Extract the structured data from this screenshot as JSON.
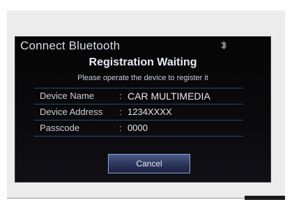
{
  "dialog": {
    "title": "Connect Bluetooth",
    "heading": "Registration Waiting",
    "subtitle": "Please operate the device to register it"
  },
  "details": [
    {
      "label": "Device Name",
      "separator": ":",
      "value": "CAR MULTIMEDIA"
    },
    {
      "label": "Device Address",
      "separator": ":",
      "value": "1234XXXX"
    },
    {
      "label": "Passcode",
      "separator": ":",
      "value": "0000"
    }
  ],
  "buttons": {
    "cancel_label": "Cancel"
  },
  "icons": {
    "status": "bluetooth-icon"
  },
  "colors": {
    "screen_bg": "#050505",
    "row_divider": "#2c4a7a",
    "button_border": "#8aa6dc",
    "button_fill": "#2a3256"
  }
}
